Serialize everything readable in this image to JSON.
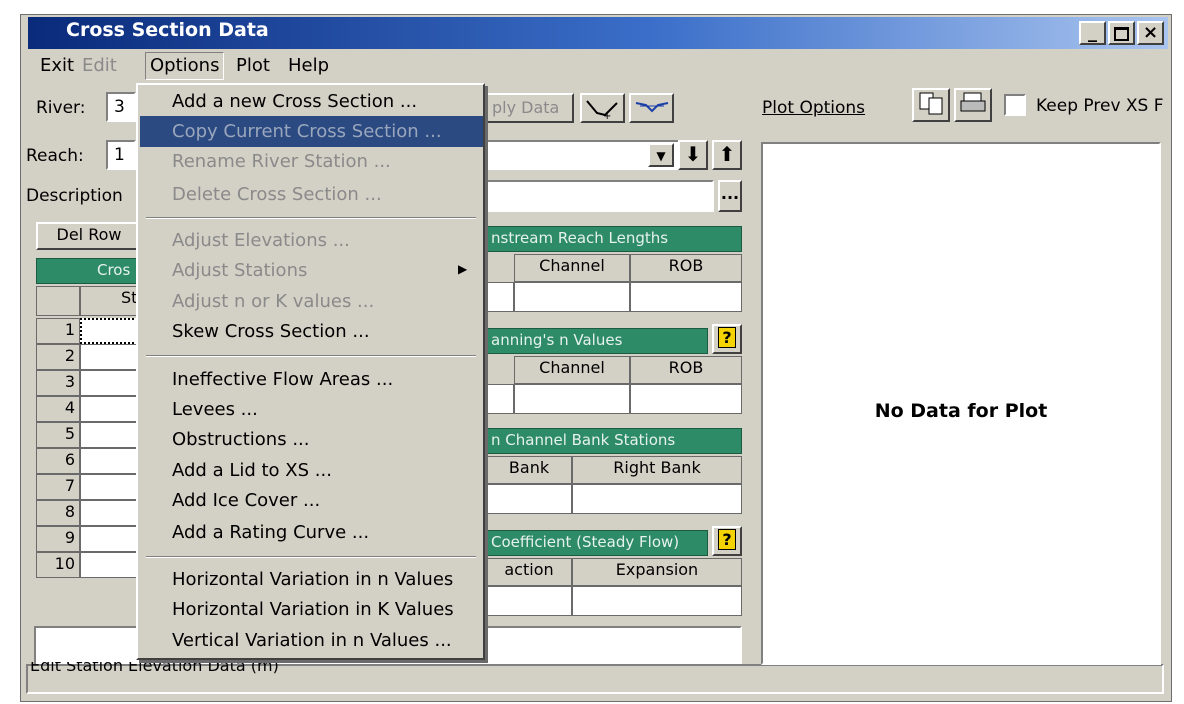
{
  "window": {
    "title": "Cross Section Data"
  },
  "menubar": [
    {
      "label": "Exit",
      "enabled": true
    },
    {
      "label": "Edit",
      "enabled": false
    },
    {
      "label": "Options",
      "enabled": true,
      "open": true
    },
    {
      "label": "Plot",
      "enabled": true
    },
    {
      "label": "Help",
      "enabled": true
    }
  ],
  "fields": {
    "river_label": "River:",
    "river_value": "3",
    "reach_label": "Reach:",
    "reach_value": "1",
    "description_label": "Description",
    "apply_data_label": "ply Data",
    "ellipsis_label": "..."
  },
  "editor": {
    "del_row_label": "Del Row",
    "grid_header": "Cros",
    "col_station": "St",
    "rows": [
      "1",
      "2",
      "3",
      "4",
      "5",
      "6",
      "7",
      "8",
      "9",
      "10"
    ]
  },
  "panels": {
    "reach_lengths": {
      "title": "nstream Reach Lengths",
      "cols": [
        "Channel",
        "ROB"
      ]
    },
    "mannings": {
      "title": "anning's n Values",
      "cols": [
        "Channel",
        "ROB"
      ]
    },
    "bank_stations": {
      "title": "n Channel Bank Stations",
      "cols": [
        "Bank",
        "Right Bank"
      ]
    },
    "coefficients": {
      "title": "Coefficient (Steady Flow)",
      "cols": [
        "action",
        "Expansion"
      ]
    }
  },
  "plot": {
    "options_label": "Plot Options",
    "keep_prev_label": "Keep Prev XS F",
    "keep_prev_checked": false,
    "no_data_text": "No Data for Plot"
  },
  "status_text": "Edit Station Elevation Data (m)",
  "options_menu": [
    {
      "label": "Add a new Cross Section ...",
      "enabled": true
    },
    {
      "label": "Copy Current Cross Section ...",
      "enabled": false,
      "highlighted": true
    },
    {
      "label": "Rename River Station ...",
      "enabled": false
    },
    {
      "label": "Delete Cross Section ...",
      "enabled": false
    },
    {
      "label": "Adjust Elevations ...",
      "enabled": false
    },
    {
      "label": "Adjust Stations",
      "enabled": false,
      "submenu": true
    },
    {
      "label": "Adjust n or K values ...",
      "enabled": false
    },
    {
      "label": "Skew Cross Section ...",
      "enabled": true
    },
    {
      "label": "Ineffective Flow Areas ...",
      "enabled": true
    },
    {
      "label": "Levees ...",
      "enabled": true
    },
    {
      "label": "Obstructions ...",
      "enabled": true
    },
    {
      "label": "Add a Lid to XS ...",
      "enabled": true
    },
    {
      "label": "Add Ice Cover ...",
      "enabled": true
    },
    {
      "label": "Add a Rating Curve ...",
      "enabled": true
    },
    {
      "label": "Horizontal Variation in n Values",
      "enabled": true
    },
    {
      "label": "Horizontal Variation in K Values",
      "enabled": true
    },
    {
      "label": "Vertical Variation in n Values ...",
      "enabled": true
    }
  ],
  "colors": {
    "title_start": "#0a2a7a",
    "title_end": "#a9c4ef",
    "panel_green": "#2e8b67",
    "menu_highlight": "#2b4a82"
  },
  "icons": [
    "minimize-icon",
    "maximize-icon",
    "close-icon",
    "arrow-down-icon",
    "arrow-up-icon",
    "copy-icon",
    "print-icon",
    "help-icon",
    "chevron-right-icon"
  ]
}
